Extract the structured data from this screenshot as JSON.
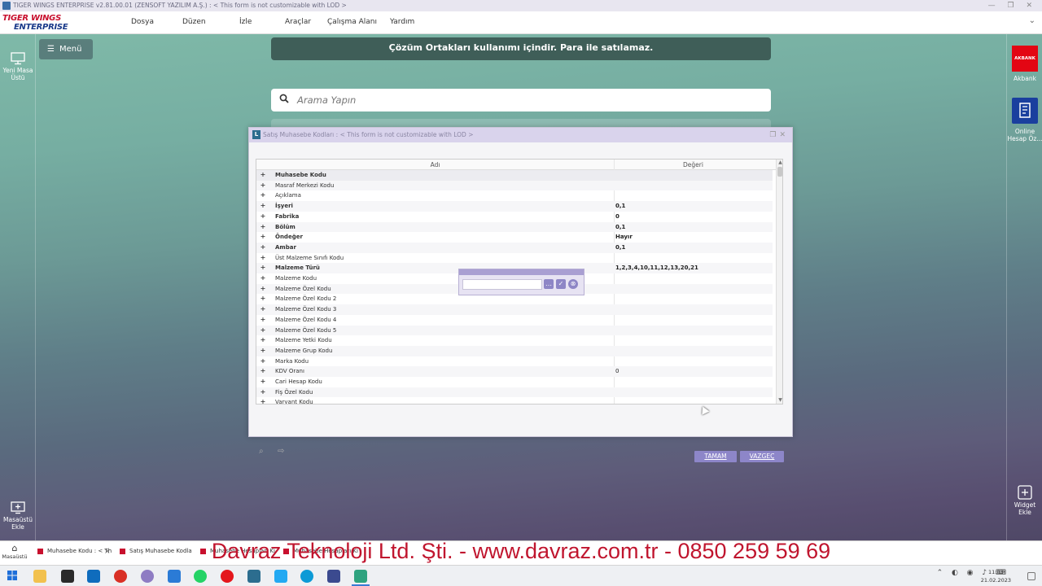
{
  "window": {
    "title": "TIGER WINGS ENTERPRISE v2.81.00.01 (ZENSOFT YAZILIM A.Ş.) : < This form is not customizable with LOD >"
  },
  "logo": {
    "line1": "TIGER WINGS",
    "line2": "ENTERPRISE",
    "tag": "ogo"
  },
  "menu": {
    "items": [
      "Dosya",
      "Düzen",
      "İzle",
      "Araçlar",
      "Çalışma Alanı",
      "Yardım"
    ]
  },
  "desktop": {
    "menu_button": "Menü",
    "banner": "Çözüm Ortakları kullanımı içindir. Para ile satılamaz.",
    "search_placeholder": "Arama Yapın",
    "left": [
      {
        "label": "Yeni Masa Üstü",
        "icon": "monitor-icon"
      },
      {
        "label": "Masaüstü Ekle",
        "icon": "add-desktop-icon"
      }
    ],
    "right": [
      {
        "label": "Akbank",
        "icon": "akbank-icon",
        "brand": "AKBANK",
        "color": "#e30613"
      },
      {
        "label": "Online Hesap Öz...",
        "icon": "statement-icon",
        "color": "#1a3f9e"
      },
      {
        "label": "Widget Ekle",
        "icon": "add-widget-icon"
      }
    ]
  },
  "dialog": {
    "title": "Satış Muhasebe Kodları : < This form is not customizable with LOD >",
    "columns": [
      "Adı",
      "Değeri"
    ],
    "rows": [
      {
        "name": "Muhasebe Kodu",
        "value": "",
        "bold": true
      },
      {
        "name": "Masraf Merkezi Kodu",
        "value": "",
        "bold": false
      },
      {
        "name": "Açıklama",
        "value": "",
        "bold": false
      },
      {
        "name": "İşyeri",
        "value": "0,1",
        "bold": true
      },
      {
        "name": "Fabrika",
        "value": "0",
        "bold": true
      },
      {
        "name": "Bölüm",
        "value": "0,1",
        "bold": true
      },
      {
        "name": "Öndeğer",
        "value": "Hayır",
        "bold": true
      },
      {
        "name": "Ambar",
        "value": "0,1",
        "bold": true
      },
      {
        "name": "Üst Malzeme Sınıfı Kodu",
        "value": "",
        "bold": false
      },
      {
        "name": "Malzeme Türü",
        "value": "1,2,3,4,10,11,12,13,20,21",
        "bold": true
      },
      {
        "name": "Malzeme Kodu",
        "value": "",
        "bold": false
      },
      {
        "name": "Malzeme Özel Kodu",
        "value": "",
        "bold": false
      },
      {
        "name": "Malzeme Özel Kodu 2",
        "value": "",
        "bold": false
      },
      {
        "name": "Malzeme Özel Kodu 3",
        "value": "",
        "bold": false
      },
      {
        "name": "Malzeme Özel Kodu 4",
        "value": "",
        "bold": false
      },
      {
        "name": "Malzeme Özel Kodu 5",
        "value": "",
        "bold": false
      },
      {
        "name": "Malzeme Yetki Kodu",
        "value": "",
        "bold": false
      },
      {
        "name": "Malzeme Grup Kodu",
        "value": "",
        "bold": false
      },
      {
        "name": "Marka Kodu",
        "value": "",
        "bold": false
      },
      {
        "name": "KDV Oranı",
        "value": "0",
        "bold": false
      },
      {
        "name": "Cari Hesap Kodu",
        "value": "",
        "bold": false
      },
      {
        "name": "Fiş Özel Kodu",
        "value": "",
        "bold": false
      },
      {
        "name": "Varyant Kodu",
        "value": "",
        "bold": false
      }
    ],
    "popup": {
      "value": "",
      "buttons": [
        "ellipsis-icon",
        "check-icon",
        "cancel-icon"
      ]
    },
    "ok": "TAMAM",
    "cancel": "VAZGEÇ"
  },
  "watermark": "Davraz Teknoloji Ltd. Şti. - www.davraz.com.tr - 0850 259 59 69",
  "app_tabs": {
    "home": "Masaüstü",
    "tabs": [
      "Muhasebe Kodu : < Th",
      "Satış Muhasebe Kodla",
      "Muhasebe Hesapları Ki",
      "Muhasebe Hesapları Ki"
    ]
  },
  "taskbar": {
    "time": "11:03",
    "date": "21.02.2023",
    "apps": [
      "windows-start-icon",
      "file-explorer-icon",
      "notes-icon",
      "outlook-icon",
      "chrome-icon",
      "tools-icon",
      "pen-icon",
      "whatsapp-icon",
      "opera-icon",
      "logo-app-icon",
      "vscode-icon",
      "edge-icon",
      "vmware-icon",
      "tiger-icon"
    ]
  }
}
